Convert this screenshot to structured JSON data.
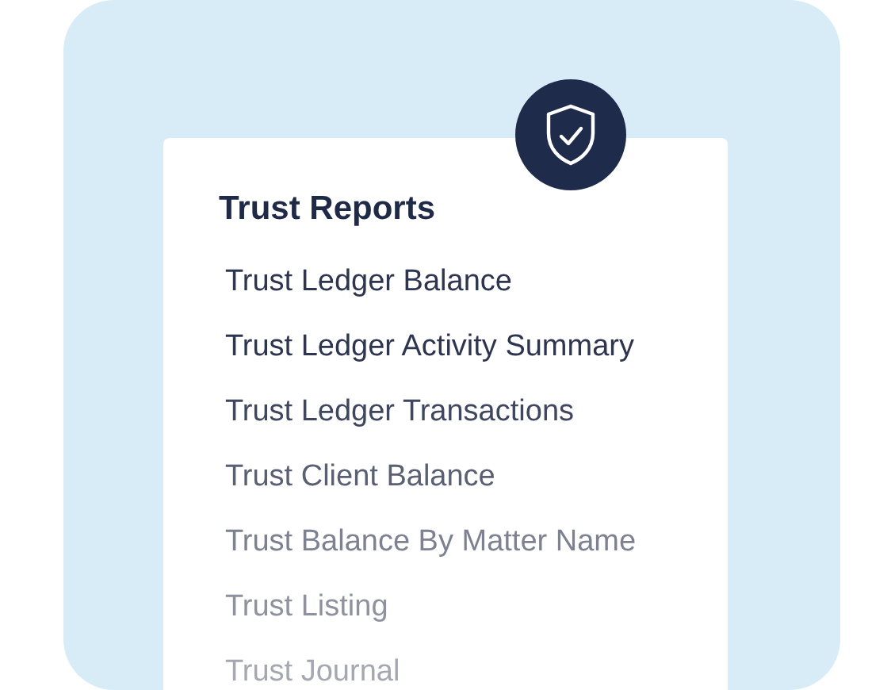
{
  "card": {
    "title": "Trust Reports",
    "items": [
      {
        "label": "Trust Ledger Balance",
        "color": "#2d3550"
      },
      {
        "label": "Trust Ledger Activity Summary",
        "color": "#2d3550"
      },
      {
        "label": "Trust Ledger Transactions",
        "color": "#3e4660"
      },
      {
        "label": "Trust Client Balance",
        "color": "#5a6074"
      },
      {
        "label": "Trust Balance By Matter Name",
        "color": "#7d8292"
      },
      {
        "label": "Trust Listing",
        "color": "#8e929e"
      },
      {
        "label": "Trust Journal",
        "color": "#a5a8b1"
      }
    ]
  }
}
